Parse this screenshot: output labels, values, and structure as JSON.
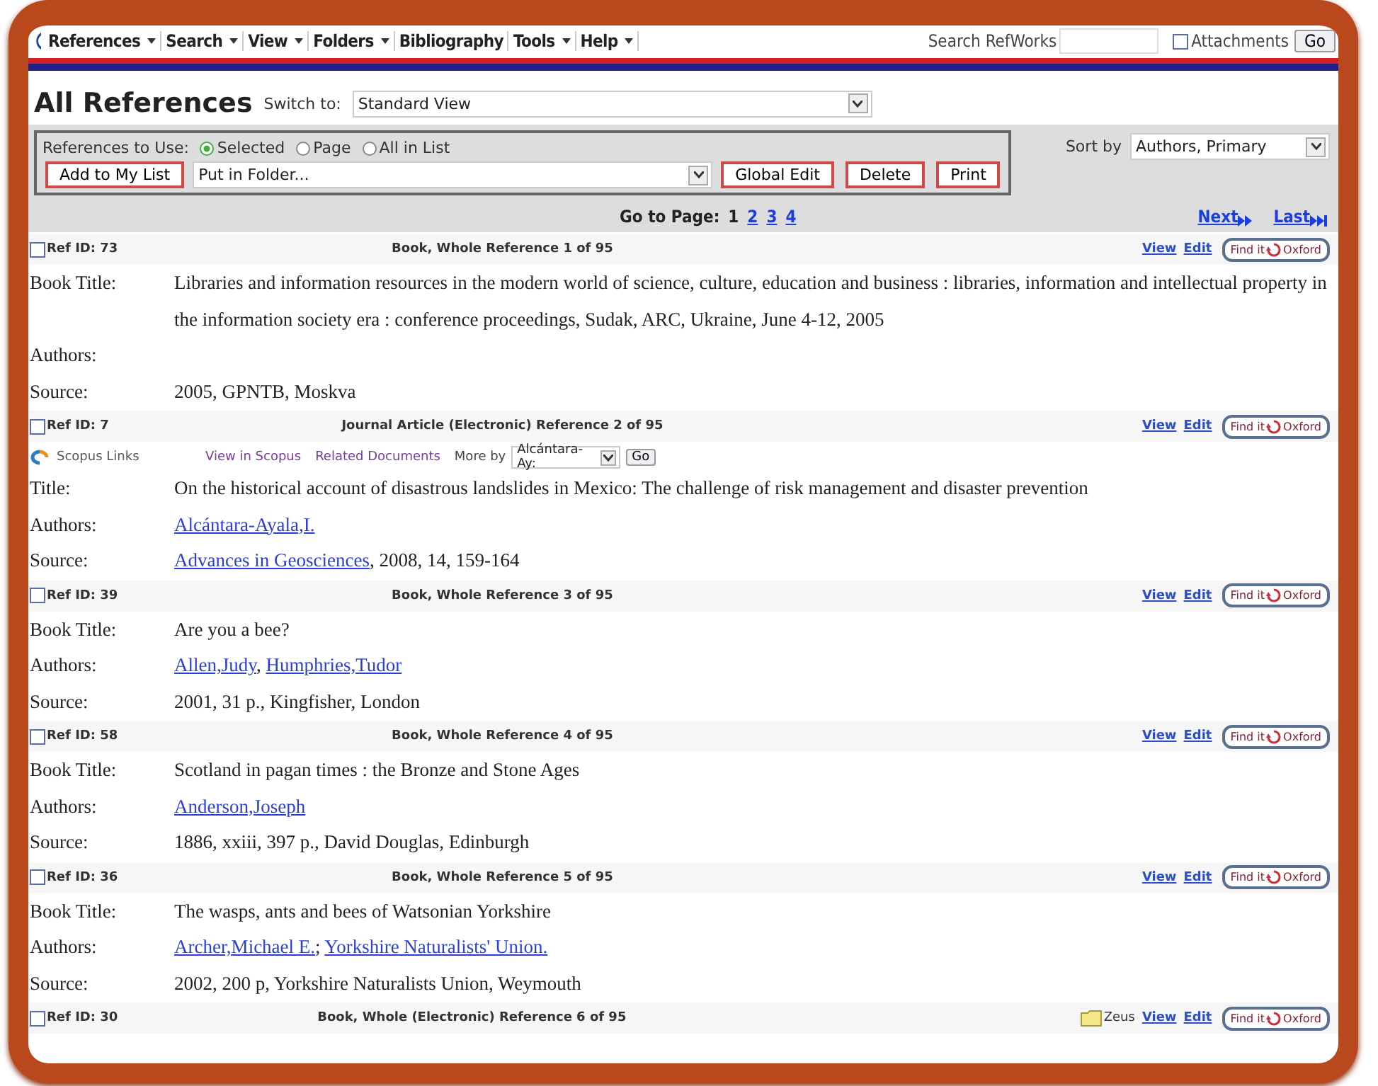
{
  "menu": [
    {
      "label": "References",
      "has_menu": true
    },
    {
      "label": "Search",
      "has_menu": true
    },
    {
      "label": "View",
      "has_menu": true
    },
    {
      "label": "Folders",
      "has_menu": true
    },
    {
      "label": "Bibliography",
      "has_menu": false
    },
    {
      "label": "Tools",
      "has_menu": true
    },
    {
      "label": "Help",
      "has_menu": true
    }
  ],
  "search": {
    "label": "Search RefWorks",
    "attachments": {
      "label": "Attachments",
      "checked": false
    },
    "go": "Go"
  },
  "title": "All References",
  "switch_to": {
    "label": "Switch to:",
    "value": "Standard View"
  },
  "toolbar": {
    "label": "References to Use:",
    "options": [
      {
        "label": "Selected",
        "selected": true
      },
      {
        "label": "Page",
        "selected": false
      },
      {
        "label": "All in List",
        "selected": false
      }
    ],
    "add_button": "Add to My List",
    "folder_select": "Put in Folder...",
    "buttons": [
      "Global Edit",
      "Delete",
      "Print"
    ]
  },
  "sort": {
    "label": "Sort by",
    "value": "Authors, Primary"
  },
  "paging": {
    "label": "Go to Page:",
    "pages": [
      {
        "label": "1",
        "selected": true
      },
      {
        "label": "2",
        "selected": false
      },
      {
        "label": "3",
        "selected": false
      },
      {
        "label": "4",
        "selected": false
      }
    ],
    "next": "Next",
    "last": "Last"
  },
  "references": [
    {
      "ref_id": "Ref ID: 73",
      "checked": false,
      "type": "Book, Whole Reference 1 of 95",
      "view": "View",
      "edit": "Edit",
      "find": [
        "Find it",
        "Oxford"
      ],
      "fields": [
        {
          "label": "Book Title:",
          "parts": [
            {
              "text": "Libraries and information resources in the modern world of science, culture, education and business : libraries, information and intellectual property in the information society era : conference proceedings, Sudak, ARC, Ukraine, June 4-12, 2005",
              "link": false
            }
          ]
        },
        {
          "label": "Authors:"
        },
        {
          "label": "Source:",
          "parts": [
            {
              "text": "2005, GPNTB, Moskva",
              "link": false
            }
          ]
        }
      ]
    },
    {
      "ref_id": "Ref ID: 7",
      "checked": false,
      "type": "Journal Article (Electronic) Reference 2 of 95",
      "view": "View",
      "edit": "Edit",
      "find": [
        "Find it",
        "Oxford"
      ],
      "scopus": {
        "label": "Scopus Links",
        "view": "View in Scopus",
        "related": "Related Documents",
        "more_by": "More by",
        "author": "Alcántara-Ay:",
        "go": "Go"
      },
      "fields": [
        {
          "label": "Title:",
          "parts": [
            {
              "text": "On the historical account of disastrous landslides in Mexico: The challenge of risk management and disaster prevention",
              "link": false
            }
          ]
        },
        {
          "label": "Authors:",
          "parts": [
            {
              "text": "Alcántara-Ayala,I.",
              "link": true
            }
          ]
        },
        {
          "label": "Source:",
          "parts": [
            {
              "text": "Advances in Geosciences",
              "link": true
            },
            {
              "text": ", 2008, 14, 159-164",
              "link": false
            }
          ]
        }
      ]
    },
    {
      "ref_id": "Ref ID: 39",
      "checked": false,
      "type": "Book, Whole Reference 3 of 95",
      "view": "View",
      "edit": "Edit",
      "find": [
        "Find it",
        "Oxford"
      ],
      "fields": [
        {
          "label": "Book Title:",
          "parts": [
            {
              "text": "Are you a bee?",
              "link": false
            }
          ]
        },
        {
          "label": "Authors:",
          "parts": [
            {
              "text": "Allen,Judy",
              "link": true
            },
            {
              "text": ", ",
              "link": false
            },
            {
              "text": "Humphries,Tudor",
              "link": true
            }
          ]
        },
        {
          "label": "Source:",
          "parts": [
            {
              "text": "2001, 31 p., Kingfisher, London",
              "link": false
            }
          ]
        }
      ]
    },
    {
      "ref_id": "Ref ID: 58",
      "checked": false,
      "type": "Book, Whole Reference 4 of 95",
      "view": "View",
      "edit": "Edit",
      "find": [
        "Find it",
        "Oxford"
      ],
      "fields": [
        {
          "label": "Book Title:",
          "parts": [
            {
              "text": "Scotland in pagan times : the Bronze and Stone Ages",
              "link": false
            }
          ]
        },
        {
          "label": "Authors:",
          "parts": [
            {
              "text": "Anderson,Joseph",
              "link": true
            }
          ]
        },
        {
          "label": "Source:",
          "parts": [
            {
              "text": "1886, xxiii, 397 p., David Douglas, Edinburgh",
              "link": false
            }
          ]
        }
      ]
    },
    {
      "ref_id": "Ref ID: 36",
      "checked": false,
      "type": "Book, Whole Reference 5 of 95",
      "view": "View",
      "edit": "Edit",
      "find": [
        "Find it",
        "Oxford"
      ],
      "fields": [
        {
          "label": "Book Title:",
          "parts": [
            {
              "text": "The wasps, ants and bees of Watsonian Yorkshire",
              "link": false
            }
          ]
        },
        {
          "label": "Authors:",
          "parts": [
            {
              "text": "Archer,Michael E.",
              "link": true
            },
            {
              "text": "; ",
              "link": false
            },
            {
              "text": "Yorkshire Naturalists' Union.",
              "link": true
            }
          ]
        },
        {
          "label": "Source:",
          "parts": [
            {
              "text": "2002, 200 p, Yorkshire Naturalists Union, Weymouth",
              "link": false
            }
          ]
        }
      ]
    },
    {
      "ref_id": "Ref ID: 30",
      "checked": false,
      "type": "Book, Whole (Electronic) Reference 6 of 95",
      "folder": "Zeus",
      "view": "View",
      "edit": "Edit",
      "find": [
        "Find it",
        "Oxford"
      ]
    }
  ]
}
